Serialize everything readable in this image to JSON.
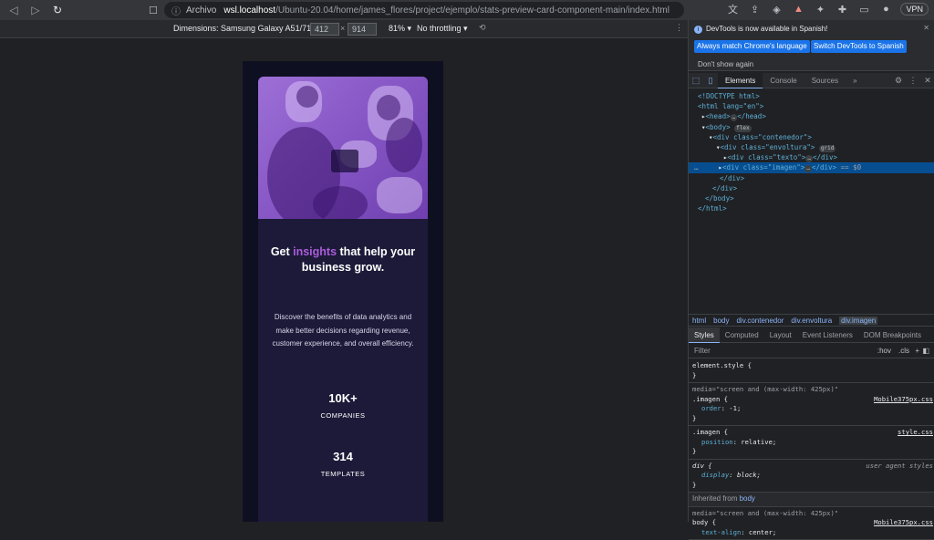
{
  "browser": {
    "archivo": "Archivo",
    "host": "wsl.localhost",
    "path": "/Ubuntu-20.04/home/james_flores/project/ejemplo/stats-preview-card-component-main/index.html",
    "vpn": "VPN",
    "notification_count": "9"
  },
  "device_toolbar": {
    "dimensions": "Dimensions: Samsung Galaxy A51/71 ▾",
    "width": "412",
    "height": "914",
    "zoom": "81% ▾",
    "throttling": "No throttling ▾"
  },
  "card": {
    "headline_pre": "Get ",
    "headline_accent": "insights",
    "headline_post": " that help your business grow.",
    "description": "Discover the benefits of data analytics and make better decisions regarding revenue, customer experience, and overall efficiency.",
    "stats": [
      {
        "num": "10K+",
        "label": "COMPANIES"
      },
      {
        "num": "314",
        "label": "TEMPLATES"
      }
    ]
  },
  "devtools": {
    "notice": "DevTools is now available in Spanish!",
    "btn_match": "Always match Chrome's language",
    "btn_switch": "Switch DevTools to Spanish",
    "dont_show": "Don't show again",
    "tabs": [
      "Elements",
      "Console",
      "Sources"
    ],
    "more": "»",
    "breadcrumbs": [
      "html",
      "body",
      "div.contenedor",
      "div.envoltura",
      "div.imagen"
    ],
    "style_tabs": [
      "Styles",
      "Computed",
      "Layout",
      "Event Listeners",
      "DOM Breakpoints"
    ],
    "filter": "Filter",
    "hov": ":hov",
    "cls": ".cls",
    "plus": "+",
    "dom": {
      "doctype": "<!DOCTYPE html>",
      "html_open": "<html lang=\"en\">",
      "head": "<head>",
      "head_close": "</head>",
      "body": "<body>",
      "flex": "flex",
      "contenedor": "<div class=\"contenedor\">",
      "envoltura": "<div class=\"envoltura\">",
      "grid": "grid",
      "texto": "<div class=\"texto\">",
      "imagen": "<div class=\"imagen\">",
      "div_close": "</div>",
      "eq": "== $0",
      "body_close": "</body>",
      "html_close": "</html>",
      "ellipsis": "…",
      "dots": "…"
    },
    "rules": {
      "element_style": "element.style {",
      "close": "}",
      "media1": "media=\"screen and (max-width: 425px)\"",
      "imagen_sel": ".imagen {",
      "imagen_src1": "Mobile375px.css",
      "order_prop": "order",
      "order_val": ": -1;",
      "imagen_src2": "style.css",
      "position_prop": "position",
      "position_val": ": relative;",
      "div_sel": "div {",
      "ua_label": "user agent styles",
      "display_prop": "display",
      "display_val": ": block;",
      "inherited_from": "Inherited from ",
      "inherited_body": "body",
      "media2": "media=\"screen and (max-width: 425px)\"",
      "body_sel": "body {",
      "body_src": "Mobile375px.css",
      "text_align_prop": "text-align",
      "text_align_val": ": center;"
    }
  }
}
